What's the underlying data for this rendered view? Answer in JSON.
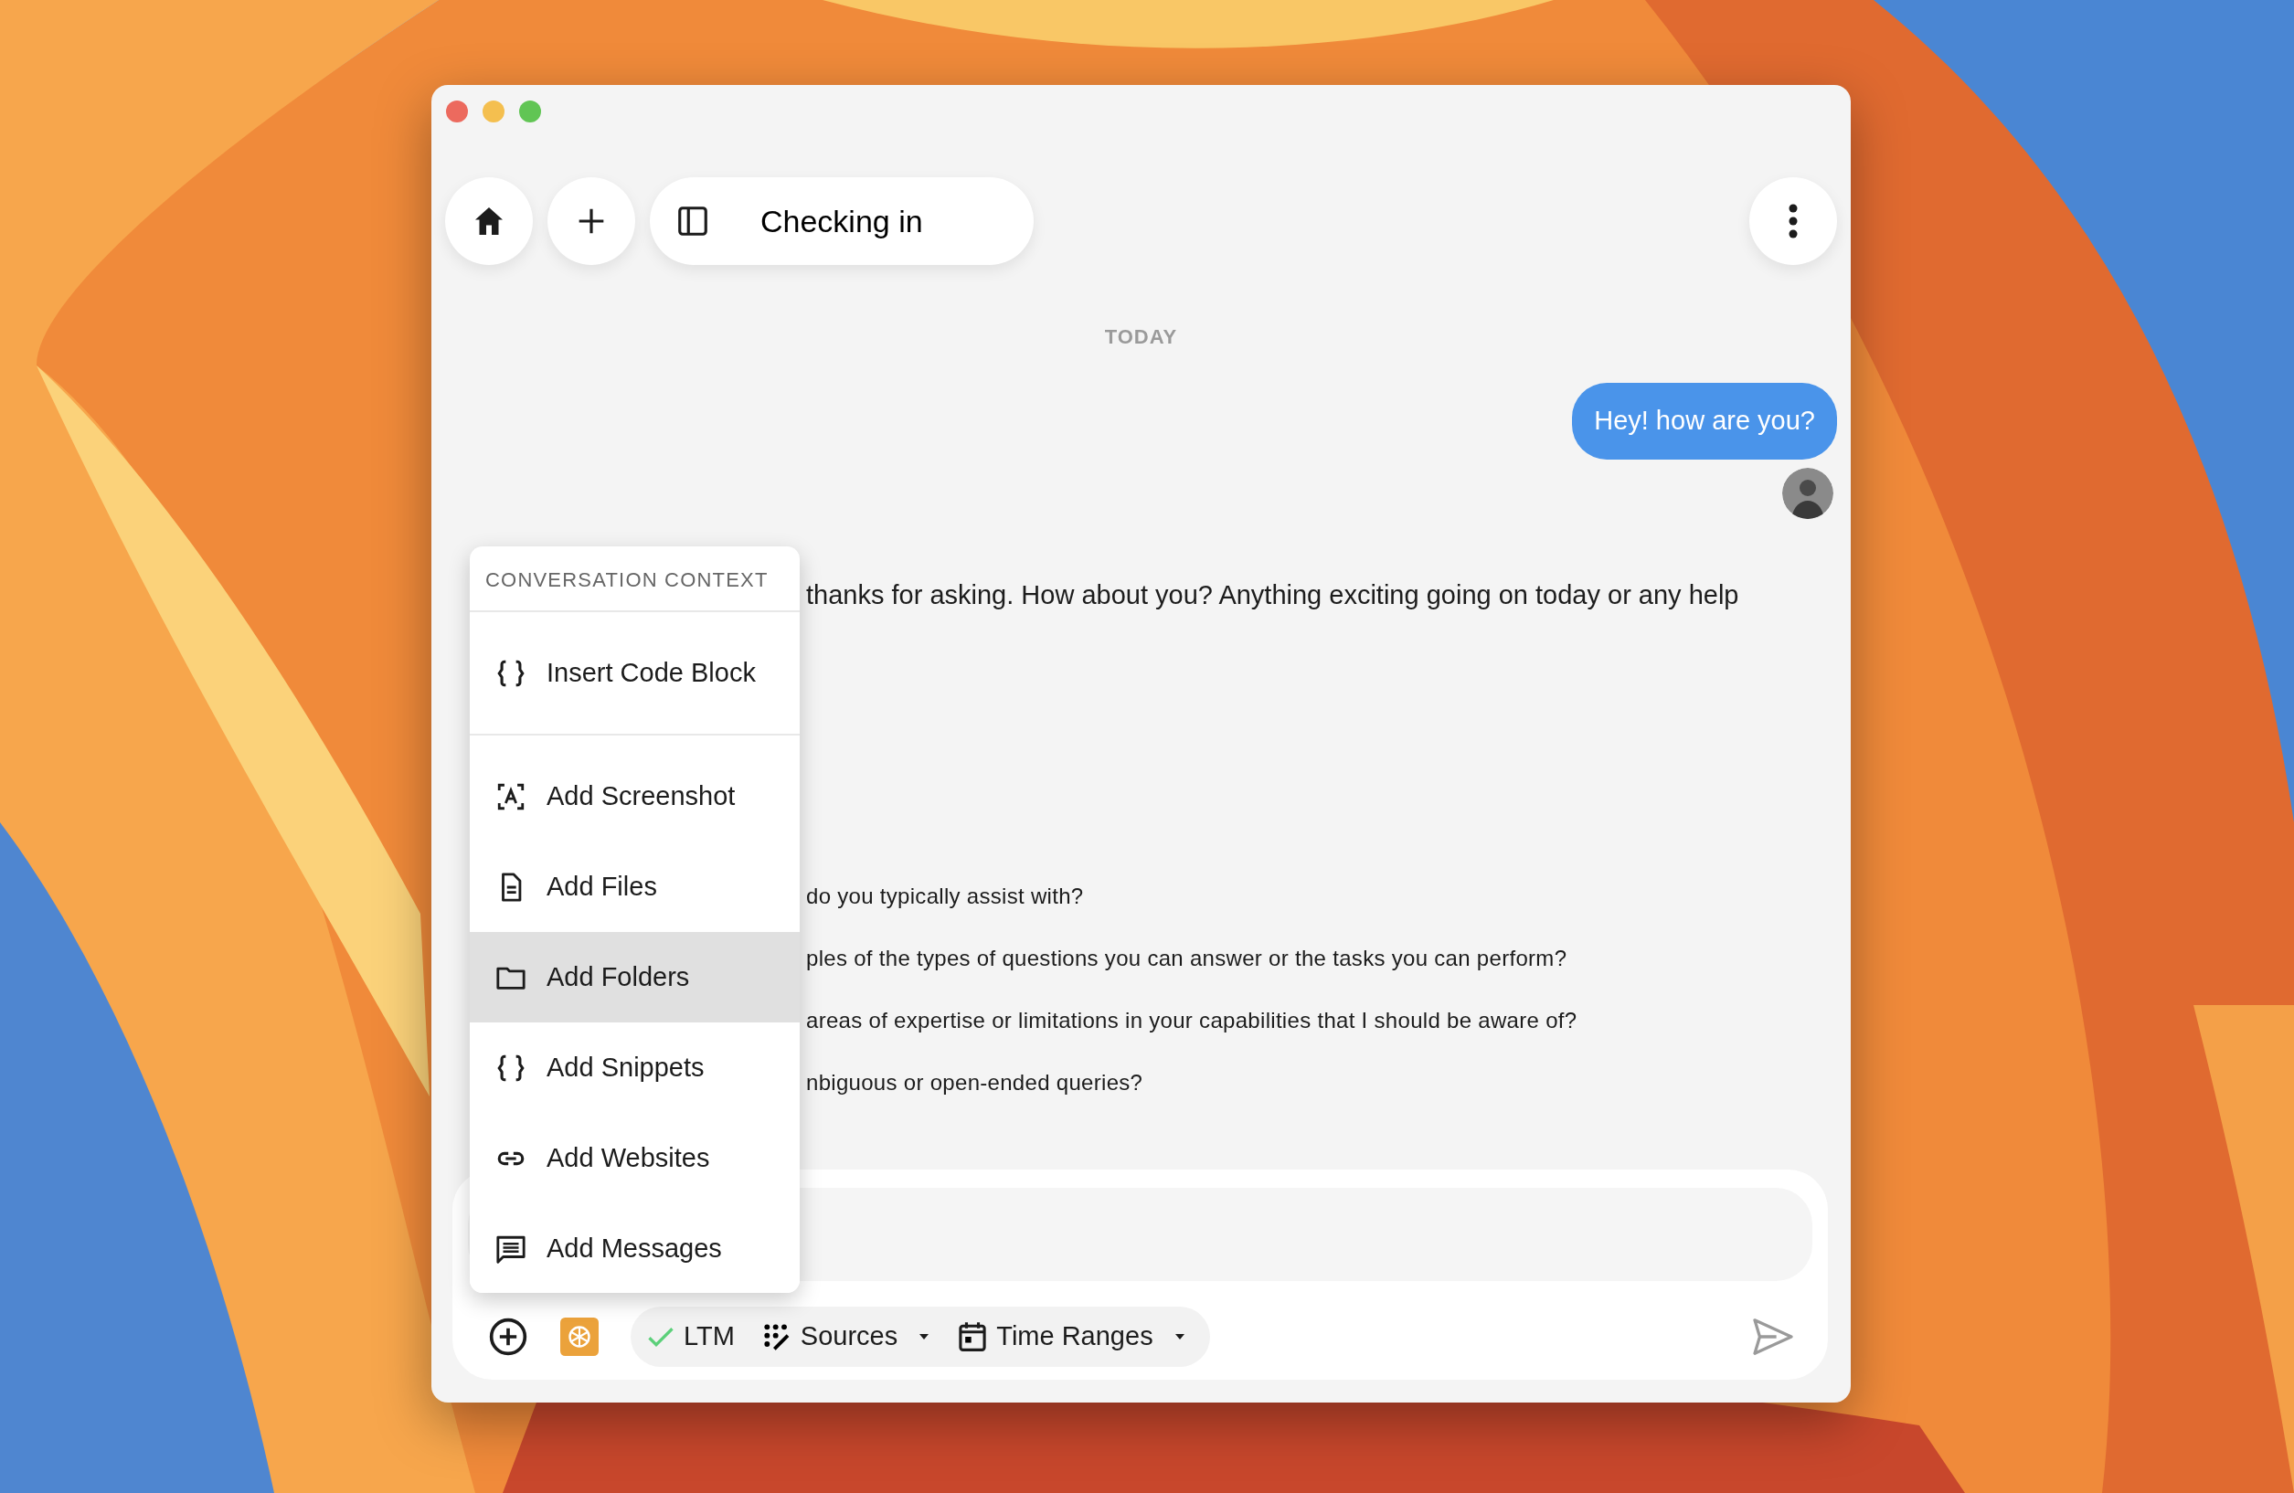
{
  "toolbar": {
    "title": "Checking in"
  },
  "date_divider": "TODAY",
  "messages": [
    {
      "kind": "user",
      "text": "Hey! how are you?"
    },
    {
      "kind": "assistant",
      "lead": "thanks for asking. How about you? Anything exciting going on today or any help",
      "lines": [
        "do you typically assist with?",
        "ples of the types of questions you can answer or the tasks you can perform?",
        "areas of expertise or limitations in your capabilities that I should be aware of?",
        "nbiguous or open-ended queries?"
      ]
    }
  ],
  "context_menu": {
    "header": "CONVERSATION CONTEXT",
    "sections": [
      [
        {
          "kind": "code",
          "label": "Insert Code Block",
          "selected": false
        }
      ],
      [
        {
          "kind": "screenshot",
          "label": "Add Screenshot",
          "selected": false
        },
        {
          "kind": "file",
          "label": "Add Files",
          "selected": false
        },
        {
          "kind": "folder",
          "label": "Add Folders",
          "selected": true
        },
        {
          "kind": "code",
          "label": "Add Snippets",
          "selected": false
        },
        {
          "kind": "link",
          "label": "Add Websites",
          "selected": false
        },
        {
          "kind": "message",
          "label": "Add Messages",
          "selected": false
        }
      ]
    ]
  },
  "composer": {
    "chips": [
      {
        "kind": "toggle",
        "label": "LTM",
        "checked": true
      },
      {
        "kind": "sources",
        "label": "Sources"
      },
      {
        "kind": "calendar",
        "label": "Time Ranges"
      }
    ]
  }
}
